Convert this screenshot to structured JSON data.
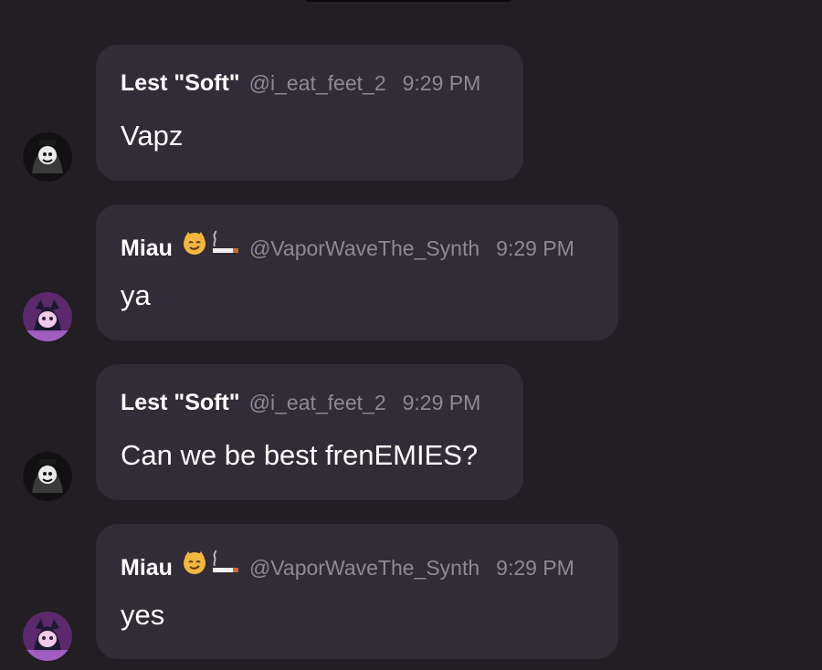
{
  "messages": [
    {
      "author": "Lest \"Soft\"",
      "handle": "@i_eat_feet_2",
      "time": "9:29 PM",
      "text": "Vapz",
      "avatar_icon": "hooded-figure-avatar-icon",
      "author_emoji": ""
    },
    {
      "author": "Miau",
      "handle": "@VaporWaveThe_Synth",
      "time": "9:29 PM",
      "text": "ya",
      "avatar_icon": "anime-catgirl-avatar-icon",
      "author_emoji": "smirking-cat-and-cigarette-emoji"
    },
    {
      "author": "Lest \"Soft\"",
      "handle": "@i_eat_feet_2",
      "time": "9:29 PM",
      "text": "Can we be best frenEMIES?",
      "avatar_icon": "hooded-figure-avatar-icon",
      "author_emoji": ""
    },
    {
      "author": "Miau",
      "handle": "@VaporWaveThe_Synth",
      "time": "9:29 PM",
      "text": "yes",
      "avatar_icon": "anime-catgirl-avatar-icon",
      "author_emoji": "smirking-cat-and-cigarette-emoji"
    }
  ],
  "colors": {
    "background": "#221e24",
    "bubble": "#312c35",
    "author_text": "#ffffff",
    "meta_text": "#8d8a93",
    "message_text": "#ffffff"
  }
}
